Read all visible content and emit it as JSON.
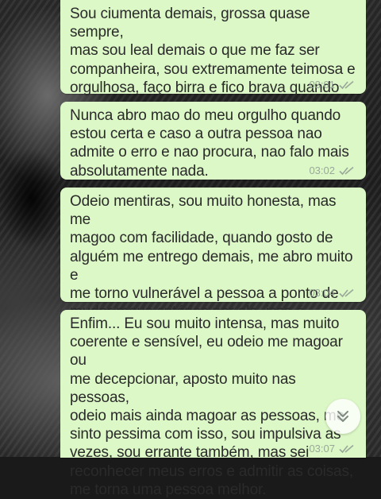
{
  "messages": [
    {
      "text": "Sou ciumenta demais, grossa quase sempre,\nmas sou leal demais o que me faz ser\ncompanheira, sou extremamente teimosa e\norgulhosa, faço birra e fico brava quando nao\né nada do meu jeito.",
      "time": "03:01"
    },
    {
      "text": "Nunca abro mao do meu orgulho quando\nestou certa e caso a outra pessoa nao\nadmite o erro e nao procura, nao falo mais\nabsolutamente nada.",
      "time": "03:02"
    },
    {
      "text": "Odeio mentiras, sou muito honesta, mas me\nmagoo com facilidade, quando gosto de\nalguém me entrego demais, me abro muito e\nme torno vulnerável a pessoa a ponto de\nmudar meus critérios por ela, isso é péssimo,\nafinal me torno intensa demais.",
      "time": "03:04"
    },
    {
      "text": "Enfim... Eu sou muito intensa, mas muito\ncoerente e sensível, eu odeio me magoar ou\nme decepcionar, aposto muito nas pessoas,\nodeio mais ainda magoar as pessoas, me\nsinto pessima com isso, sou impulsiva as\nvezes, sou errante também, mas sei\nreconhecer meus erros e admitir as coisas,\nme torna uma pessoa melhor.",
      "time": "03:07"
    }
  ],
  "colors": {
    "bubble": "#dcf8c6",
    "text": "#2a2a2a",
    "meta": "#9aa89a"
  },
  "icons": {
    "read_receipt": "double-check-icon",
    "scroll_down": "double-chevron-down-icon"
  }
}
